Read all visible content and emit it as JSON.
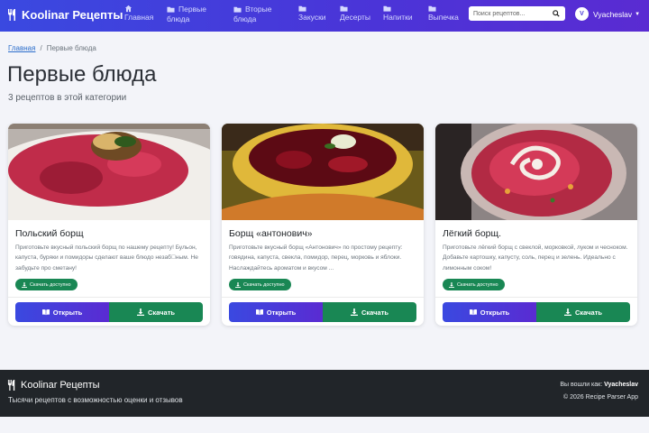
{
  "nav": {
    "brand": "Koolinar Рецепты",
    "items": [
      {
        "label": "Главная",
        "icon": "home-icon"
      },
      {
        "label1": "Первые",
        "label2": "блюда",
        "icon": "folder-icon"
      },
      {
        "label1": "Вторые",
        "label2": "блюда",
        "icon": "folder-icon"
      },
      {
        "label": "Закуски",
        "icon": "folder-icon"
      },
      {
        "label": "Десерты",
        "icon": "folder-icon"
      },
      {
        "label": "Напитки",
        "icon": "folder-icon"
      },
      {
        "label": "Выпечка",
        "icon": "folder-icon"
      }
    ],
    "search_placeholder": "Поиск рецептов...",
    "user_initial": "V",
    "user_name": "Vyacheslav"
  },
  "breadcrumb": {
    "home": "Главная",
    "separator": "/",
    "current": "Первые блюда"
  },
  "header": {
    "title": "Первые блюда",
    "subtitle": "3 рецептов в этой категории"
  },
  "cards": [
    {
      "title": "Польский борщ",
      "description": "Приготовьте вкусный польский борщ по нашему рецепту! Бульон, капуста, буряки и помидоры сделают ваше блюдо незаб\u0000ным. Не забудьте про сметану!",
      "badge": "Скачать доступно",
      "open_label": "Открыть",
      "download_label": "Скачать"
    },
    {
      "title": "Борщ «антонович»",
      "description": "Приготовьте вкусный борщ «Антонович» по простому рецепту: говядина, капуста, свекла, помидор, перец, морковь и яблоки. Наслаждайтесь ароматом и вкусом ...",
      "badge": "Скачать доступно",
      "open_label": "Открыть",
      "download_label": "Скачать"
    },
    {
      "title": "Лёгкий борщ.",
      "description": "Приготовьте лёгкий борщ с свеклой, морковкой, луком и чесноком. Добавьте картошку, капусту, соль, перец и зелень. Идеально с лимонным соком!",
      "badge": "Скачать доступно",
      "open_label": "Открыть",
      "download_label": "Скачать"
    }
  ],
  "footer": {
    "brand": "Koolinar Рецепты",
    "tagline": "Тысячи рецептов с возможностью оценки и отзывов",
    "logged_in_prefix": "Вы вошли как:",
    "logged_in_user": "Vyacheslav",
    "copyright": "© 2026 Recipe Parser App"
  },
  "colors": {
    "nav_gradient_start": "#3a49e0",
    "nav_gradient_end": "#5a2bd2",
    "success": "#198754",
    "footer_bg": "#212529"
  }
}
